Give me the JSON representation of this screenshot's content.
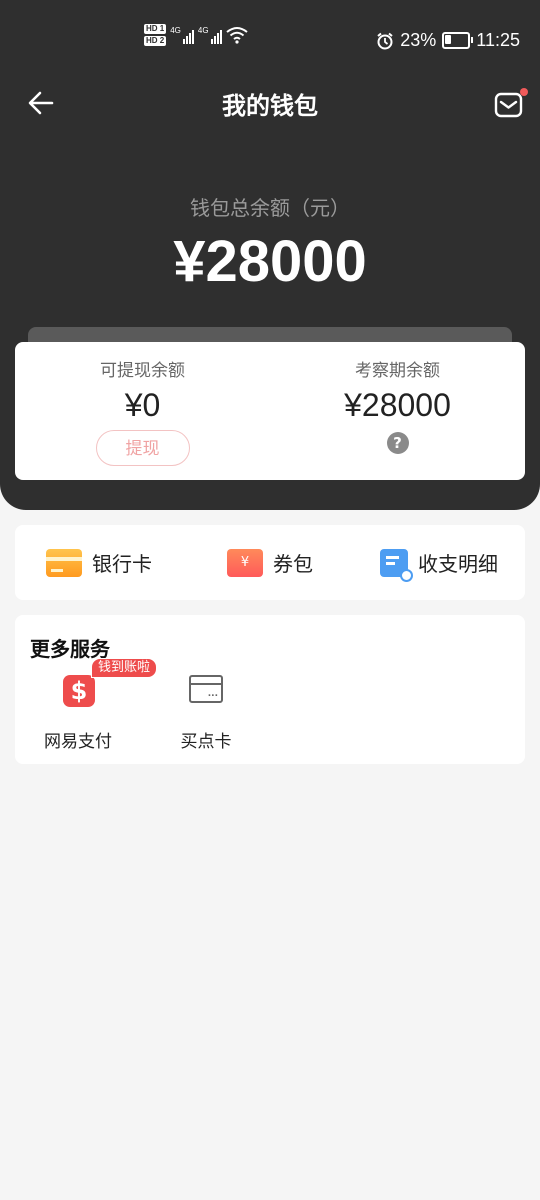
{
  "status_bar": {
    "hd1": "HD 1",
    "hd2": "HD 2",
    "net1": "4G",
    "net2": "4G",
    "battery": "23%",
    "time": "11:25"
  },
  "nav": {
    "title": "我的钱包"
  },
  "wallet": {
    "total_label": "钱包总余额（元）",
    "total_amount": "¥28000"
  },
  "balances": {
    "withdrawable_label": "可提现余额",
    "withdrawable_value": "¥0",
    "withdraw_button": "提现",
    "review_label": "考察期余额",
    "review_value": "¥28000",
    "help_symbol": "?"
  },
  "quick_links": [
    {
      "label": "银行卡",
      "icon": "bank-card-icon"
    },
    {
      "label": "券包",
      "icon": "coupon-icon",
      "icon_text": "¥"
    },
    {
      "label": "收支明细",
      "icon": "transaction-detail-icon"
    }
  ],
  "services": {
    "title": "更多服务",
    "items": [
      {
        "label": "网易支付",
        "icon": "netease-pay-icon",
        "badge": "钱到账啦"
      },
      {
        "label": "买点卡",
        "icon": "point-card-icon"
      }
    ]
  },
  "colors": {
    "header_bg": "#2f2f2f",
    "accent_red": "#ee4c4c",
    "page_bg": "#f5f5f5"
  }
}
